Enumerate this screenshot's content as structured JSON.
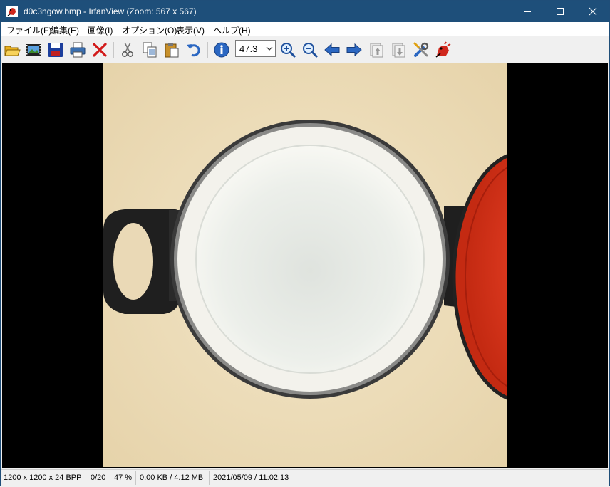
{
  "window": {
    "title": "d0c3ngow.bmp - IrfanView (Zoom: 567 x 567)"
  },
  "title_buttons": {
    "minimize": "minimize-icon",
    "maximize": "maximize-icon",
    "close": "close-icon"
  },
  "menu": {
    "items": [
      {
        "label": "ファイル(F)"
      },
      {
        "label": "編集(E)"
      },
      {
        "label": "画像(I)"
      },
      {
        "label": "オプション(O)"
      },
      {
        "label": "表示(V)"
      },
      {
        "label": "ヘルプ(H)"
      }
    ]
  },
  "toolbar": {
    "zoom_value": "47.3",
    "icons": [
      "open-folder-icon",
      "slideshow-icon",
      "save-icon",
      "print-icon",
      "delete-icon",
      "cut-icon",
      "copy-icon",
      "paste-icon",
      "undo-icon",
      "info-icon",
      "zoom-in-icon",
      "zoom-out-icon",
      "previous-icon",
      "next-icon",
      "page-up-icon",
      "page-down-icon",
      "settings-icon",
      "about-icon"
    ]
  },
  "status": {
    "dimensions": "1200 x 1200 x 24 BPP",
    "position": "0/20",
    "zoom": "47 %",
    "size": "0.00 KB / 4.12 MB",
    "datetime": "2021/05/09 / 11:02:13"
  },
  "colors": {
    "titlebar": "#1e4f7a",
    "viewport": "#000000",
    "countertop": "#eedfbf",
    "lid": "#e63a1e"
  }
}
